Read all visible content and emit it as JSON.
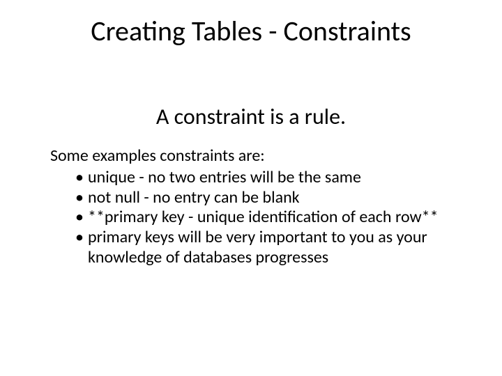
{
  "title": "Creating Tables - Constraints",
  "subtitle": "A constraint is a rule.",
  "lead": "Some examples constraints are:",
  "bullets": [
    "unique - no two entries will be the same",
    "not null - no entry can be blank",
    "**primary key - unique identification of each row**",
    "primary keys will be very important to you as your knowledge of databases progresses"
  ]
}
